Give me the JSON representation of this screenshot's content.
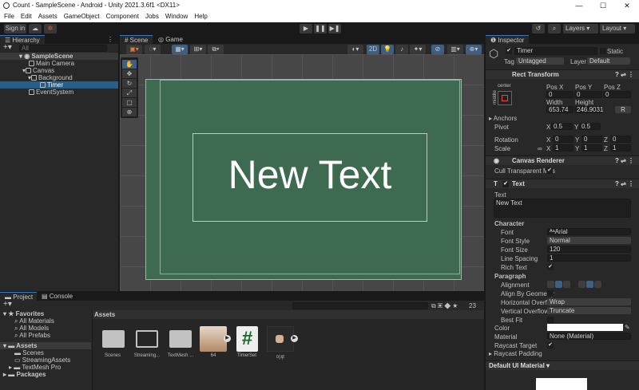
{
  "window": {
    "title": "Count - SampleScene - Android - Unity 2021.3.6f1 <DX11>",
    "minimize": "—",
    "maximize": "☐",
    "close": "✕"
  },
  "menu": [
    "File",
    "Edit",
    "Assets",
    "GameObject",
    "Component",
    "Jobs",
    "Window",
    "Help"
  ],
  "toolbar": {
    "sign_in": "Sign in",
    "layers": "Layers",
    "layout": "Layout"
  },
  "hierarchy": {
    "tab": "Hierarchy",
    "search_placeholder": "All",
    "items": [
      {
        "label": "SampleScene",
        "depth": 0
      },
      {
        "label": "Main Camera",
        "depth": 1
      },
      {
        "label": "Canvas",
        "depth": 1
      },
      {
        "label": "Background",
        "depth": 2
      },
      {
        "label": "Timer",
        "depth": 3,
        "selected": true
      },
      {
        "label": "EventSystem",
        "depth": 1
      }
    ]
  },
  "scene": {
    "tabs": [
      "Scene",
      "Game"
    ],
    "mode_2d": "2D",
    "text": "New Text"
  },
  "inspector": {
    "tab": "Inspector",
    "object_name": "Timer",
    "static": "Static",
    "tag_label": "Tag",
    "tag": "Untagged",
    "layer_label": "Layer",
    "layer": "Default",
    "rect": {
      "title": "Rect Transform",
      "anchor_h": "center",
      "anchor_v": "middle",
      "posx_l": "Pos X",
      "posy_l": "Pos Y",
      "posz_l": "Pos Z",
      "posx": "0",
      "posy": "0",
      "posz": "0",
      "width_l": "Width",
      "height_l": "Height",
      "width": "653.74",
      "height": "246.9031",
      "r": "R",
      "anchors": "Anchors",
      "pivot": "Pivot",
      "pivot_x": "0.5",
      "pivot_y": "0.5",
      "rotation": "Rotation",
      "rot_x": "0",
      "rot_y": "0",
      "rot_z": "0",
      "scale": "Scale",
      "sc_x": "1",
      "sc_y": "1",
      "sc_z": "1",
      "x": "X",
      "y": "Y",
      "z": "Z"
    },
    "canvas_renderer": {
      "title": "Canvas Renderer",
      "cull": "Cull Transparent Mes"
    },
    "text": {
      "title": "Text",
      "text_label": "Text",
      "text_value": "New Text",
      "character": "Character",
      "font_l": "Font",
      "font": "Arial",
      "font_style_l": "Font Style",
      "font_style": "Normal",
      "font_size_l": "Font Size",
      "font_size": "120",
      "line_spacing_l": "Line Spacing",
      "line_spacing": "1",
      "rich_text_l": "Rich Text",
      "paragraph": "Paragraph",
      "alignment_l": "Alignment",
      "align_geo_l": "Align By Geometry",
      "h_overflow_l": "Horizontal Overflo",
      "h_overflow": "Wrap",
      "v_overflow_l": "Vertical Overflow",
      "v_overflow": "Truncate",
      "best_fit_l": "Best Fit",
      "color_l": "Color",
      "color": "#ffffff",
      "material_l": "Material",
      "material": "None (Material)",
      "raycast_target_l": "Raycast Target",
      "raycast_padding_l": "Raycast Padding"
    },
    "material_preview": "Default UI Material"
  },
  "project": {
    "tabs": [
      "Project",
      "Console"
    ],
    "hidden_count": "23",
    "breadcrumb": "Assets",
    "tree": [
      {
        "label": "Favorites",
        "depth": 0
      },
      {
        "label": "All Materials",
        "depth": 1
      },
      {
        "label": "All Models",
        "depth": 1
      },
      {
        "label": "All Prefabs",
        "depth": 1
      },
      {
        "label": "Assets",
        "depth": 0
      },
      {
        "label": "Scenes",
        "depth": 1
      },
      {
        "label": "StreamingAssets",
        "depth": 1
      },
      {
        "label": "TextMesh Pro",
        "depth": 1
      },
      {
        "label": "Packages",
        "depth": 0
      }
    ],
    "assets": [
      "Scenes",
      "Streaming...",
      "TextMesh ...",
      "64",
      "TimerSet",
      "이루"
    ]
  }
}
